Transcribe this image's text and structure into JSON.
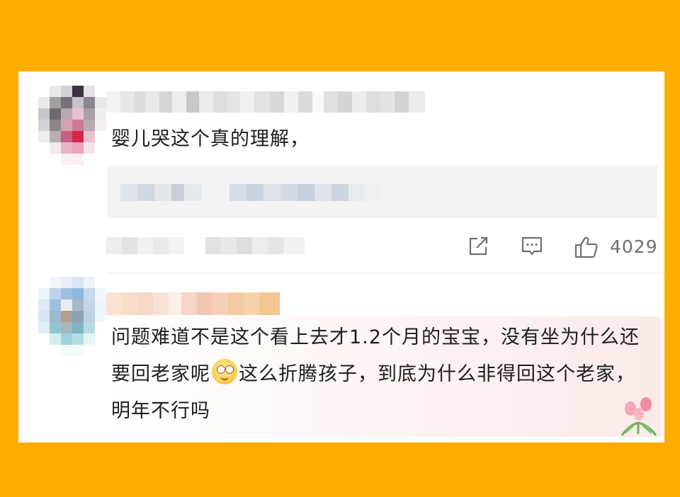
{
  "comments": [
    {
      "text": "婴儿哭这个真的理解，",
      "actions": {
        "like_count": "4029",
        "share_icon": "share-icon",
        "reply_icon": "comment-icon",
        "like_icon": "thumbs-up-icon"
      }
    },
    {
      "text_before_emoji": "问题难道不是这个看上去才1.2个月的宝宝，没有坐为什么还要回老家呢",
      "emoji": "rolling-eyes-emoji",
      "text_after_emoji": "这么折腾孩子，到底为什么非得回这个老家，明年不行吗",
      "decoration": "tulip-flower-icon"
    }
  ],
  "colors": {
    "background": "#FFAD00",
    "card": "#FFFFFF",
    "text": "#1D1D1D",
    "icon": "#6F6F6F"
  }
}
